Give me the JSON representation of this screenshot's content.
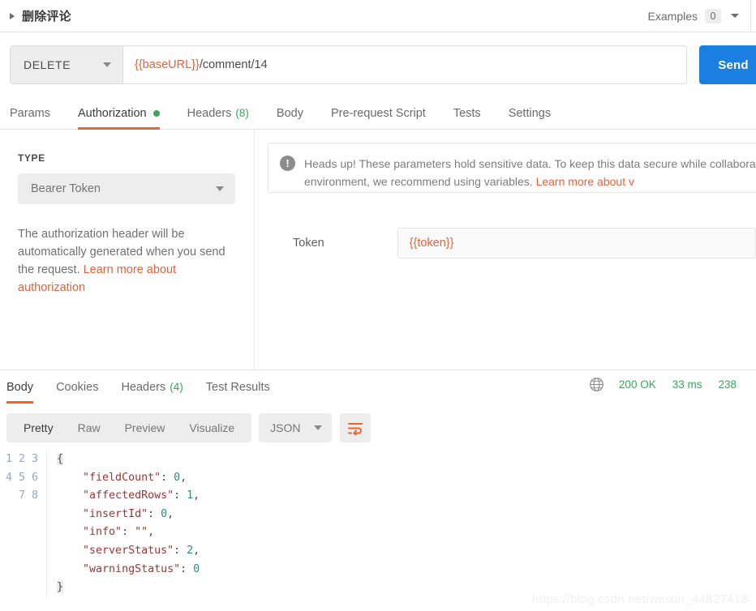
{
  "header": {
    "title": "删除评论",
    "collapse_icon": "triangle-right-icon",
    "examples_label": "Examples",
    "examples_count": "0",
    "examples_caret_icon": "chevron-down-icon"
  },
  "request": {
    "method": "DELETE",
    "method_caret_icon": "chevron-down-icon",
    "url_variable": "{{baseURL}}",
    "url_path": "/comment/14",
    "send_label": "Send"
  },
  "request_tabs": [
    {
      "label": "Params",
      "badge": "",
      "dot": false,
      "active": false
    },
    {
      "label": "Authorization",
      "badge": "",
      "dot": true,
      "active": true
    },
    {
      "label": "Headers",
      "badge": "(8)",
      "dot": false,
      "active": false
    },
    {
      "label": "Body",
      "badge": "",
      "dot": false,
      "active": false
    },
    {
      "label": "Pre-request Script",
      "badge": "",
      "dot": false,
      "active": false
    },
    {
      "label": "Tests",
      "badge": "",
      "dot": false,
      "active": false
    },
    {
      "label": "Settings",
      "badge": "",
      "dot": false,
      "active": false
    }
  ],
  "auth": {
    "type_label": "TYPE",
    "type_value": "Bearer Token",
    "type_caret_icon": "chevron-down-icon",
    "help_text": "The authorization header will be automatically generated when you send the request. ",
    "help_link": "Learn more about authorization",
    "warning_icon": "exclamation-circle-icon",
    "warning_text": "Heads up! These parameters hold sensitive data. To keep this data secure while collaborative environment, we recommend using variables. ",
    "warning_link": "Learn more about v",
    "token_label": "Token",
    "token_value": "{{token}}"
  },
  "response": {
    "tabs": [
      {
        "label": "Body",
        "badge": "",
        "active": true
      },
      {
        "label": "Cookies",
        "badge": "",
        "active": false
      },
      {
        "label": "Headers",
        "badge": "(4)",
        "active": false
      },
      {
        "label": "Test Results",
        "badge": "",
        "active": false
      }
    ],
    "globe_icon": "globe-icon",
    "status": "200 OK",
    "time": "33 ms",
    "size": "238",
    "format_tabs": [
      {
        "label": "Pretty",
        "active": true
      },
      {
        "label": "Raw",
        "active": false
      },
      {
        "label": "Preview",
        "active": false
      },
      {
        "label": "Visualize",
        "active": false
      }
    ],
    "language": "JSON",
    "language_caret_icon": "chevron-down-icon",
    "wrap_icon": "wrap-text-icon",
    "line_numbers": [
      "1",
      "2",
      "3",
      "4",
      "5",
      "6",
      "7",
      "8"
    ],
    "body_lines": [
      {
        "indent": 0,
        "open_brace": "{"
      },
      {
        "indent": 1,
        "key": "\"fieldCount\"",
        "colon": ": ",
        "num": "0",
        "comma": ","
      },
      {
        "indent": 1,
        "key": "\"affectedRows\"",
        "colon": ": ",
        "num": "1",
        "comma": ","
      },
      {
        "indent": 1,
        "key": "\"insertId\"",
        "colon": ": ",
        "num": "0",
        "comma": ","
      },
      {
        "indent": 1,
        "key": "\"info\"",
        "colon": ": ",
        "str": "\"\"",
        "comma": ","
      },
      {
        "indent": 1,
        "key": "\"serverStatus\"",
        "colon": ": ",
        "num": "2",
        "comma": ","
      },
      {
        "indent": 1,
        "key": "\"warningStatus\"",
        "colon": ": ",
        "num": "0",
        "comma": ""
      },
      {
        "indent": 0,
        "close_brace": "}"
      }
    ]
  },
  "watermark": "https://blog.csdn.net/weixin_44827418",
  "colors": {
    "accent_orange": "#f0642b",
    "link_orange": "#e8613c",
    "send_blue": "#1a7fe0",
    "success_green": "#3ba55c",
    "json_key": "#a03535",
    "json_number": "#2e8a7d"
  }
}
